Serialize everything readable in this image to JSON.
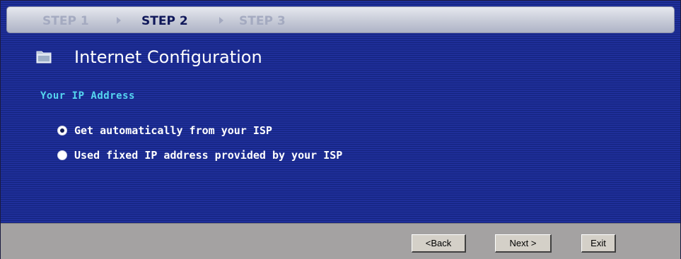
{
  "wizard": {
    "steps": [
      {
        "label": "STEP 1",
        "state": "inactive"
      },
      {
        "label": "STEP 2",
        "state": "active"
      },
      {
        "label": "STEP 3",
        "state": "inactive"
      }
    ]
  },
  "page": {
    "title": "Internet Configuration",
    "icon": "folder-icon"
  },
  "section": {
    "title": "Your IP Address"
  },
  "ip_options": [
    {
      "label": "Get automatically from your ISP",
      "selected": true
    },
    {
      "label": "Used fixed IP address provided by your ISP",
      "selected": false
    }
  ],
  "footer": {
    "back_label": "<Back",
    "next_label": "Next >",
    "exit_label": "Exit"
  },
  "colors": {
    "panel_background": "#192a8f",
    "section_title": "#55d6f0",
    "footer_background": "#a4a2a2",
    "step_active": "#10185a",
    "step_inactive": "#a4aac0"
  }
}
